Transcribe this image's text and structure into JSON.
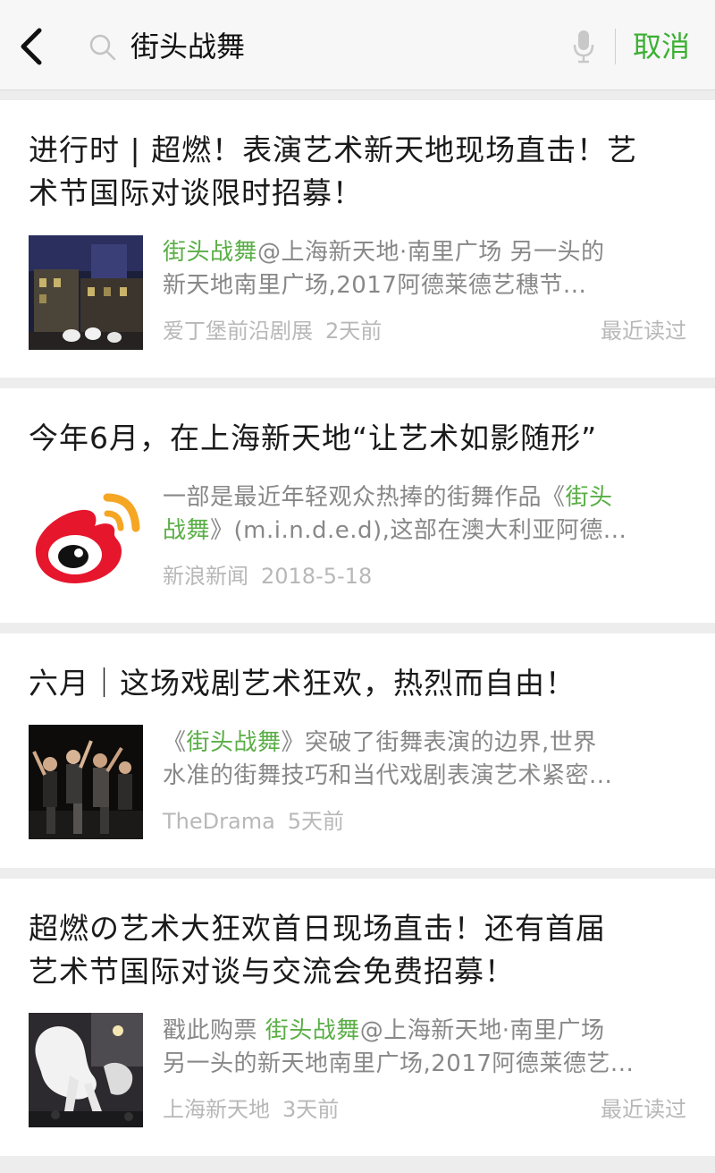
{
  "search": {
    "query": "街头战舞",
    "cancel_label": "取消"
  },
  "colors": {
    "accent_green": "#3cb034",
    "highlight_green": "#5aae46",
    "meta_gray": "#b8b8b8"
  },
  "results": [
    {
      "title_line1": "进行时 | 超燃！表演艺术新天地现场直击！艺",
      "title_line2": "术节国际对谈限时招募！",
      "snippet_l1_hl": "街头战舞",
      "snippet_l1_rest": "@上海新天地·南里广场 另一头的",
      "snippet_l2": "新天地南里广场,2017阿德莱德艺穗节...",
      "source": "爱丁堡前沿剧展",
      "date": "2天前",
      "read_flag": "最近读过",
      "thumb_icon": "night-street-photo"
    },
    {
      "title_line1": "今年6月，在上海新天地“让艺术如影随形”",
      "snippet_l1_pre": "一部是最近年轻观众热捧的街舞作品《",
      "snippet_l1_hl": "街头",
      "snippet_l2_hl": "战舞",
      "snippet_l2_rest": "》(m.i.n.d.e.d),这部在澳大利亚阿德...",
      "source": "新浪新闻",
      "date": "2018-5-18",
      "thumb_icon": "weibo-logo"
    },
    {
      "title_line1": "六月｜这场戏剧艺术狂欢，热烈而自由！",
      "snippet_l1_pre": "《",
      "snippet_l1_hl": "街头战舞",
      "snippet_l1_rest": "》突破了街舞表演的边界,世界",
      "snippet_l2": "水准的街舞技巧和当代戏剧表演艺术紧密...",
      "source": "TheDrama",
      "date": "5天前",
      "thumb_icon": "dancers-photo"
    },
    {
      "title_line1": "超燃の艺术大狂欢首日现场直击！还有首届",
      "title_line2": "艺术节国际对谈与交流会免费招募！",
      "snippet_l1_pre": "戳此购票 ",
      "snippet_l1_hl": "街头战舞",
      "snippet_l1_rest": "@上海新天地·南里广场",
      "snippet_l2": "另一头的新天地南里广场,2017阿德莱德艺...",
      "source": "上海新天地",
      "date": "3天前",
      "read_flag": "最近读过",
      "thumb_icon": "white-horse-photo"
    }
  ]
}
